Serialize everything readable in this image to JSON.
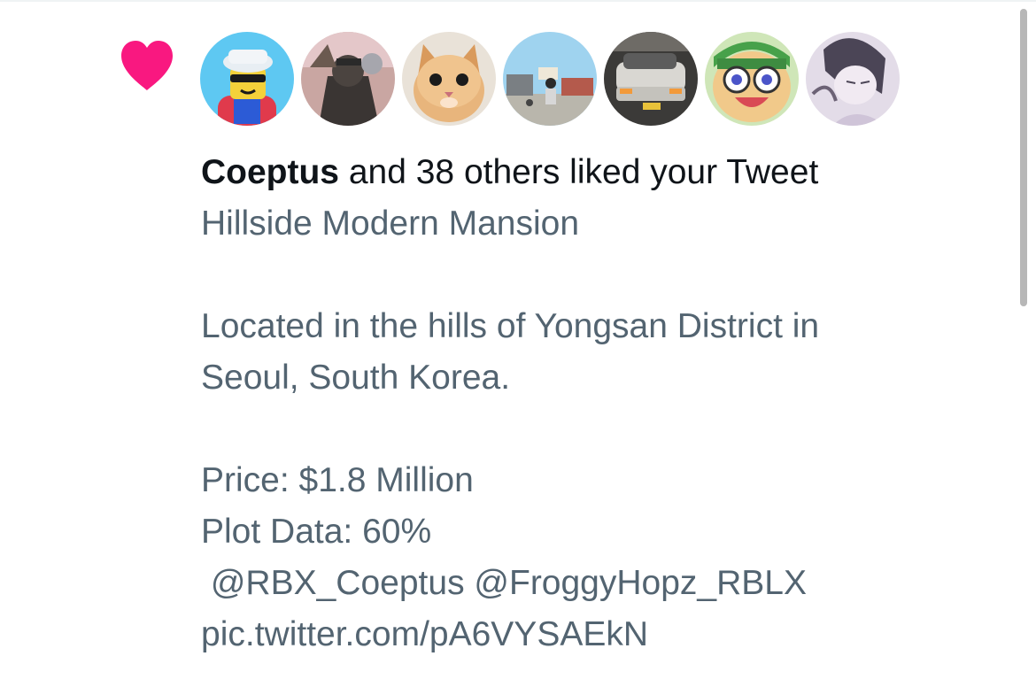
{
  "notification": {
    "type_icon": "heart-icon",
    "accent_color": "#f91880",
    "summary": {
      "username": "Coeptus",
      "rest": " and 38 others liked your Tweet"
    },
    "tweet_lines": [
      "Hillside Modern Mansion",
      "",
      "Located in the hills of Yongsan District in",
      "Seoul, South Korea.",
      "",
      "Price: $1.8 Million",
      "Plot Data: 60%",
      " @RBX_Coeptus @FroggyHopz_RBLX",
      "pic.twitter.com/pA6VYSAEkN"
    ],
    "avatars": [
      {
        "label": "roblox-character-avatar"
      },
      {
        "label": "dark-figure-avatar"
      },
      {
        "label": "kitten-avatar"
      },
      {
        "label": "game-street-avatar"
      },
      {
        "label": "car-avatar"
      },
      {
        "label": "frog-character-avatar"
      },
      {
        "label": "anime-sketch-avatar"
      }
    ]
  }
}
